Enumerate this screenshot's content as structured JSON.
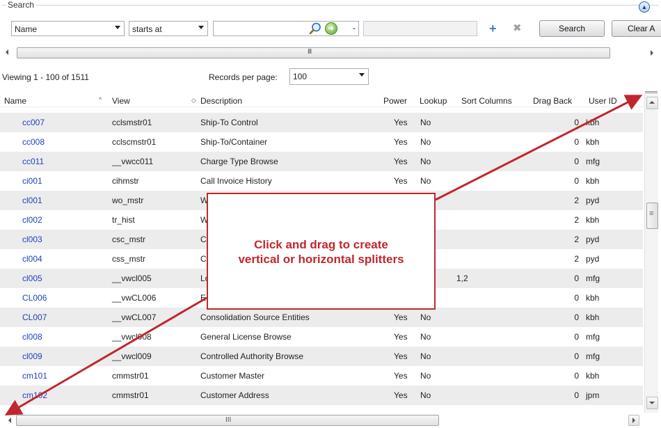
{
  "search": {
    "legend": "Search",
    "field": "Name",
    "operator": "starts at",
    "value": "",
    "value2": "",
    "range_separator": "-",
    "search_button": "Search",
    "clear_button": "Clear A"
  },
  "top_scrollbar": {
    "grip": "III"
  },
  "paging": {
    "viewing": "Viewing  1 - 100  of  1511",
    "records_per_page_label": "Records per page:",
    "records_per_page": "100"
  },
  "grid": {
    "columns": [
      "Name",
      "View",
      "Description",
      "Power",
      "Lookup",
      "Sort Columns",
      "Drag Back",
      "User ID"
    ],
    "name_sort_icon": "^",
    "view_sort_icon": "◇",
    "rows": [
      [
        "cc007",
        "cclsmstr01",
        "Ship-To Control",
        "Yes",
        "No",
        "",
        "0",
        "kbh"
      ],
      [
        "cc008",
        "cclscmstr01",
        "Ship-To/Container",
        "Yes",
        "No",
        "",
        "0",
        "kbh"
      ],
      [
        "cc011",
        "__vwcc011",
        "Charge Type Browse",
        "Yes",
        "No",
        "",
        "0",
        "mfg"
      ],
      [
        "ci001",
        "cihmstr",
        "Call Invoice History",
        "Yes",
        "No",
        "",
        "0",
        "kbh"
      ],
      [
        "cl001",
        "wo_mstr",
        "W",
        "",
        "No",
        "",
        "2",
        "pyd"
      ],
      [
        "cl002",
        "tr_hist",
        "W",
        "",
        "No",
        "",
        "2",
        "kbh"
      ],
      [
        "cl003",
        "csc_mstr",
        "C",
        "",
        "No",
        "",
        "2",
        "pyd"
      ],
      [
        "cl004",
        "css_mstr",
        "C",
        "",
        "No",
        "",
        "2",
        "pyd"
      ],
      [
        "cl005",
        "__vwcl005",
        "Lo",
        "",
        "No",
        "1,2",
        "0",
        "mfg"
      ],
      [
        "CL006",
        "__vwCL006",
        "E",
        "",
        "No",
        "",
        "0",
        "kbh"
      ],
      [
        "CL007",
        "__vwCL007",
        "Consolidation Source Entities",
        "Yes",
        "No",
        "",
        "0",
        "kbh"
      ],
      [
        "cl008",
        "__vwcl008",
        "General License Browse",
        "Yes",
        "No",
        "",
        "0",
        "mfg"
      ],
      [
        "cl009",
        "__vwcl009",
        "Controlled Authority Browse",
        "Yes",
        "No",
        "",
        "0",
        "mfg"
      ],
      [
        "cm101",
        "cmmstr01",
        "Customer Master",
        "Yes",
        "No",
        "",
        "0",
        "kbh"
      ],
      [
        "cm102",
        "cmmstr01",
        "Customer Address",
        "Yes",
        "No",
        "",
        "0",
        "jpm"
      ]
    ]
  },
  "bottom_scrollbar": {
    "grip": "III"
  },
  "callout": {
    "line1": "Click and drag to create",
    "line2": "vertical or horizontal splitters"
  },
  "colors": {
    "link": "#1f3fbd",
    "callout": "#c0272d",
    "row_alt": "#ececec"
  },
  "icons": [
    "collapse-icon",
    "lookup-icon",
    "go-icon",
    "add-icon",
    "remove-icon",
    "dropdown-arrow-icon"
  ]
}
